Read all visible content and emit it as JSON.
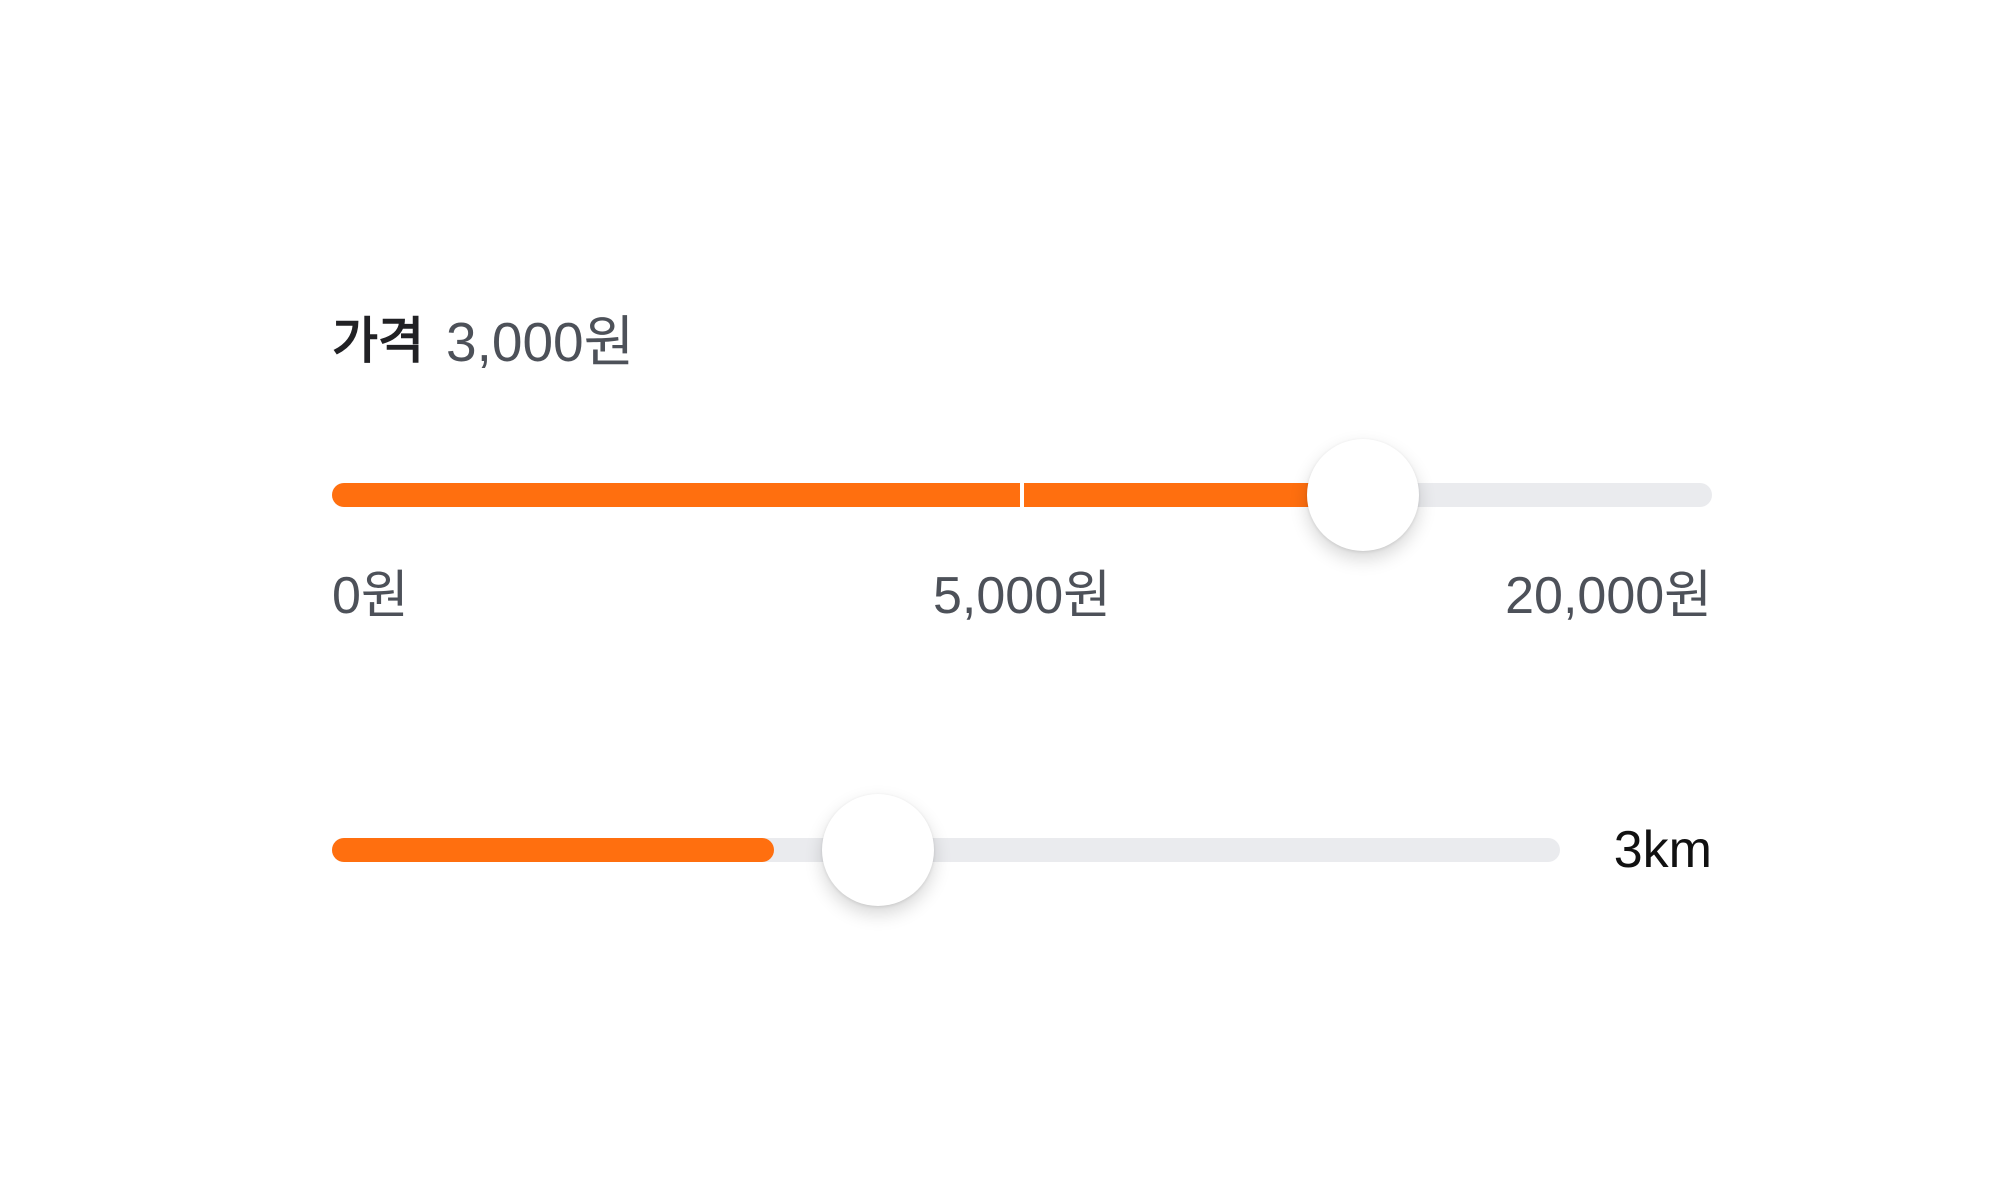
{
  "colors": {
    "accent": "#ff6f0f",
    "track": "#eaebee",
    "thumb": "#ffffff",
    "title_text": "#212124",
    "secondary_text": "#4d5159",
    "value_text": "#111111"
  },
  "price_filter": {
    "title": "가격",
    "current_value": "3,000원",
    "slider": {
      "fill_fraction": 0.745,
      "step_divider_fraction": 0.5
    },
    "tick_labels": {
      "min": "0원",
      "mid": "5,000원",
      "max": "20,000원"
    }
  },
  "distance_filter": {
    "value_label": "3km",
    "slider": {
      "fill_fraction": 0.36
    }
  }
}
